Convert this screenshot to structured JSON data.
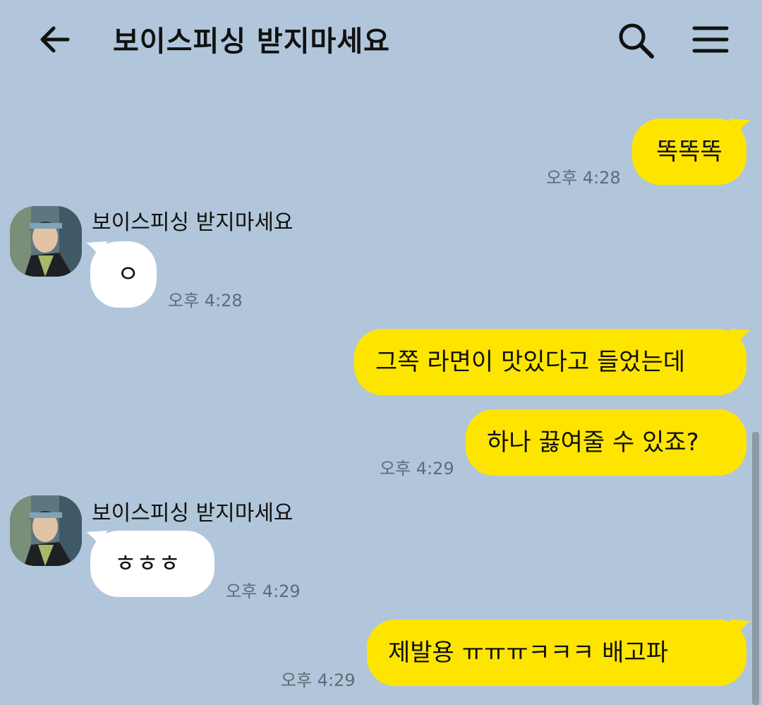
{
  "header": {
    "title": "보이스피싱 받지마세요",
    "back_icon": "arrow-left-icon",
    "search_icon": "search-icon",
    "menu_icon": "hamburger-menu-icon"
  },
  "colors": {
    "background": "#b1c6da",
    "outgoing_bubble": "#fee500",
    "incoming_bubble": "#ffffff",
    "timestamp": "#5f6b76"
  },
  "messages": [
    {
      "direction": "out",
      "text": "똑똑똑",
      "time": "오후 4:28"
    },
    {
      "direction": "in",
      "sender": "보이스피싱 받지마세요",
      "text": "ㅇ",
      "time": "오후 4:28"
    },
    {
      "direction": "out",
      "text": "그쪽 라면이 맛있다고 들었는데",
      "time": ""
    },
    {
      "direction": "out",
      "text": "하나 끓여줄 수 있죠?",
      "time": "오후 4:29"
    },
    {
      "direction": "in",
      "sender": "보이스피싱 받지마세요",
      "text": "ㅎㅎㅎ",
      "time": "오후 4:29"
    },
    {
      "direction": "out",
      "text": "제발용 ㅠㅠㅠㅋㅋㅋ 배고파",
      "time": "오후 4:29"
    }
  ]
}
